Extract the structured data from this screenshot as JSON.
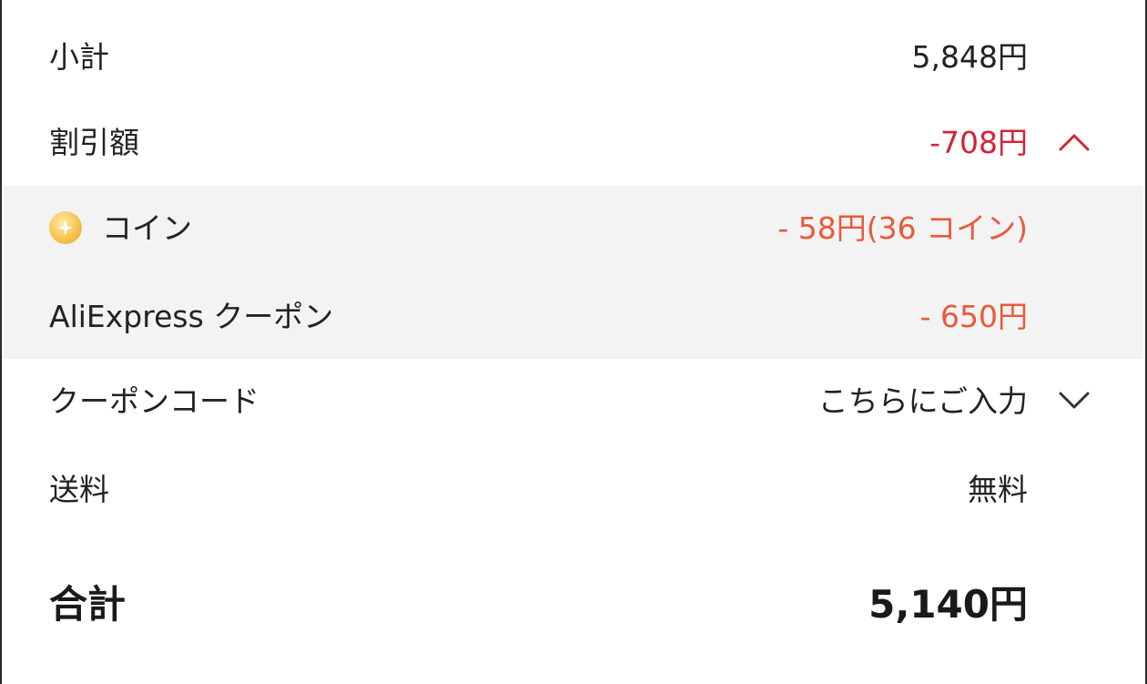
{
  "summary": {
    "subtotal": {
      "label": "小計",
      "value": "5,848円"
    },
    "discount": {
      "label": "割引額",
      "value": "-708円",
      "expanded": true
    },
    "discount_items": [
      {
        "label": "コイン",
        "value": "- 58円(36 コイン)",
        "icon": "coin-icon"
      },
      {
        "label": "AliExpress クーポン",
        "value": "- 650円"
      }
    ],
    "coupon_code": {
      "label": "クーポンコード",
      "value": "こちらにご入力"
    },
    "shipping": {
      "label": "送料",
      "value": "無料"
    },
    "total": {
      "label": "合計",
      "value": "5,140円"
    }
  },
  "colors": {
    "discount_red": "#d0243b",
    "discount_item_orange": "#e85a3c",
    "breakdown_background": "#f3f3f3"
  }
}
